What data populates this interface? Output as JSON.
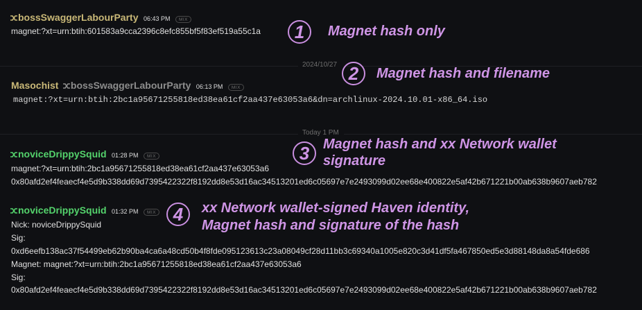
{
  "dividers": {
    "d1_label": "2024/10/27",
    "d2_label": "Today 1 PM"
  },
  "messages": [
    {
      "username": "bossSwaggerLabourParty",
      "time": "06:43 PM",
      "mix_tag": "MIX",
      "lines": [
        "magnet:?xt=urn:btih:601583a9cca2396c8efc855bf5f83ef519a55c1a"
      ]
    },
    {
      "username": "Masochist",
      "username_extra": "bossSwaggerLabourParty",
      "time": "06:13 PM",
      "mix_tag": "MIX",
      "lines": [
        "magnet:?xt=urn:btih:2bc1a95671255818ed38ea61cf2aa437e63053a6&dn=archlinux-2024.10.01-x86_64.iso"
      ]
    },
    {
      "username": "noviceDrippySquid",
      "time": "01:28 PM",
      "mix_tag": "MIX",
      "lines": [
        "magnet:?xt=urn:btih:2bc1a95671255818ed38ea61cf2aa437e63053a6",
        "0x80afd2ef4feaecf4e5d9b338dd69d7395422322f8192dd8e53d16ac34513201ed6c05697e7e2493099d02ee68e400822e5af42b671221b00ab638b9607aeb782"
      ]
    },
    {
      "username": "noviceDrippySquid",
      "time": "01:32 PM",
      "mix_tag": "MIX",
      "lines": [
        "Nick: noviceDrippySquid",
        "Sig:",
        "0xd6eefb138ac37f54499eb62b90ba4ca6a48cd50b4f8fde095123613c23a08049cf28d11bb3c69340a1005e820c3d41df5fa467850ed5e3d88148da8a54fde686",
        "Magnet: magnet:?xt=urn:btih:2bc1a95671255818ed38ea61cf2aa437e63053a6",
        "Sig:",
        "0x80afd2ef4feaecf4e5d9b338dd69d7395422322f8192dd8e53d16ac34513201ed6c05697e7e2493099d02ee68e400822e5af42b671221b00ab638b9607aeb782"
      ]
    }
  ],
  "annotations": [
    {
      "number": "1",
      "text": "Magnet hash only"
    },
    {
      "number": "2",
      "text": "Magnet hash and filename"
    },
    {
      "number": "3",
      "line1": "Magnet hash and xx Network wallet",
      "line2": "signature"
    },
    {
      "number": "4",
      "line1": "xx Network wallet-signed Haven identity,",
      "line2": "Magnet hash and signature of the hash"
    }
  ],
  "colors": {
    "accent": "#cf95e6",
    "username_gold": "#c9b877",
    "username_green": "#54d36c"
  },
  "icons": {
    "mix_icon": "shuffle-icon"
  }
}
